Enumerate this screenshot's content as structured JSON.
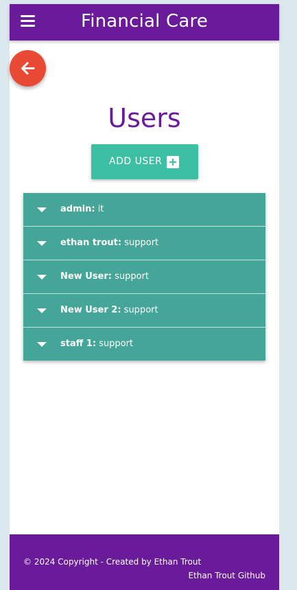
{
  "header": {
    "title": "Financial Care",
    "menu_icon": "hamburger-menu-icon"
  },
  "back_button": {
    "icon": "arrow-left-icon"
  },
  "page": {
    "title": "Users"
  },
  "add_user": {
    "label": "ADD USER",
    "icon": "plus-box-icon"
  },
  "users": [
    {
      "name": "admin",
      "role": "it"
    },
    {
      "name": "ethan trout",
      "role": "support"
    },
    {
      "name": "New User",
      "role": "support"
    },
    {
      "name": "New User 2",
      "role": "support"
    },
    {
      "name": "staff 1",
      "role": "support"
    }
  ],
  "footer": {
    "copyright": "© 2024 Copyright - Created by Ethan Trout",
    "github_link": "Ethan Trout Github"
  },
  "colors": {
    "primary": "#6a1b9a",
    "accent": "#3dbfa4",
    "list_row": "#45a598",
    "back_button": "#e84a35"
  }
}
